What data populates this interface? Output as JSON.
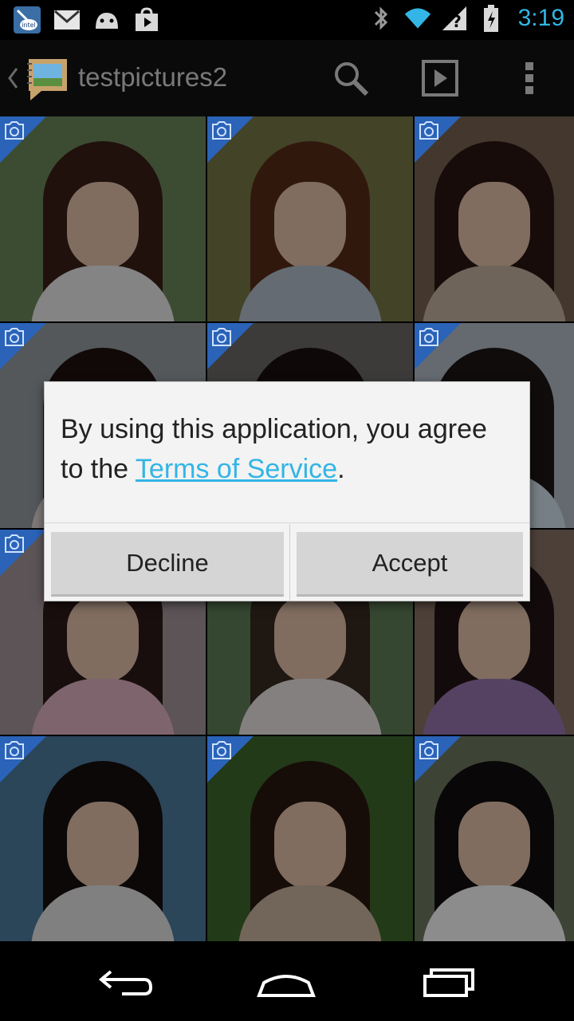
{
  "status_bar": {
    "time": "3:19",
    "icons_left": [
      "intel-app-icon",
      "gmail-icon",
      "android-debug-icon",
      "play-store-icon"
    ],
    "icons_right": [
      "bluetooth-icon",
      "wifi-icon",
      "signal-unknown-icon",
      "battery-charging-icon"
    ]
  },
  "action_bar": {
    "title": "testpictures2",
    "icons": [
      "up-chevron-icon",
      "album-app-icon",
      "search-icon",
      "slideshow-icon",
      "overflow-menu-icon"
    ]
  },
  "grid": {
    "tiles": [
      {
        "hair": "#3b1f16",
        "bg": "#6e8b5d",
        "shirt": "#f1f1f1"
      },
      {
        "hair": "#5a2d18",
        "bg": "#7b7a48",
        "shirt": "#b7c3d0"
      },
      {
        "hair": "#2a1713",
        "bg": "#7a6455",
        "shirt": "#c8b7a4"
      },
      {
        "hair": "#1e1210",
        "bg": "#9aa0a7",
        "shirt": "#e6dada"
      },
      {
        "hair": "#1b1210",
        "bg": "#6d6c6a",
        "shirt": "#dedede"
      },
      {
        "hair": "#201616",
        "bg": "#b6c2cc",
        "shirt": "#d7e8f2"
      },
      {
        "hair": "#2c1b18",
        "bg": "#a89a9e",
        "shirt": "#e6b7c7"
      },
      {
        "hair": "#3a2a20",
        "bg": "#61805a",
        "shirt": "#f0eaea"
      },
      {
        "hair": "#231414",
        "bg": "#8c7668",
        "shirt": "#9b78b5"
      },
      {
        "hair": "#161010",
        "bg": "#4f7ea2",
        "shirt": "#e9e9e9"
      },
      {
        "hair": "#2a1810",
        "bg": "#3f6a2d",
        "shirt": "#cfb9a3"
      },
      {
        "hair": "#120d0d",
        "bg": "#6f7b62",
        "shirt": "#ffffff"
      }
    ],
    "badge_color": "#2a63b8",
    "badge_icon": "camera-icon"
  },
  "dialog": {
    "message_before_link": "By using this application, you agree to the ",
    "link_text": "Terms of Service",
    "message_after_link": ".",
    "decline_label": "Decline",
    "accept_label": "Accept"
  },
  "nav_bar": {
    "icons": [
      "back-icon",
      "home-icon",
      "recent-apps-icon"
    ]
  },
  "colors": {
    "accent": "#33b5e5",
    "dialog_bg": "#f3f3f3",
    "button_bg": "#d5d5d5"
  }
}
